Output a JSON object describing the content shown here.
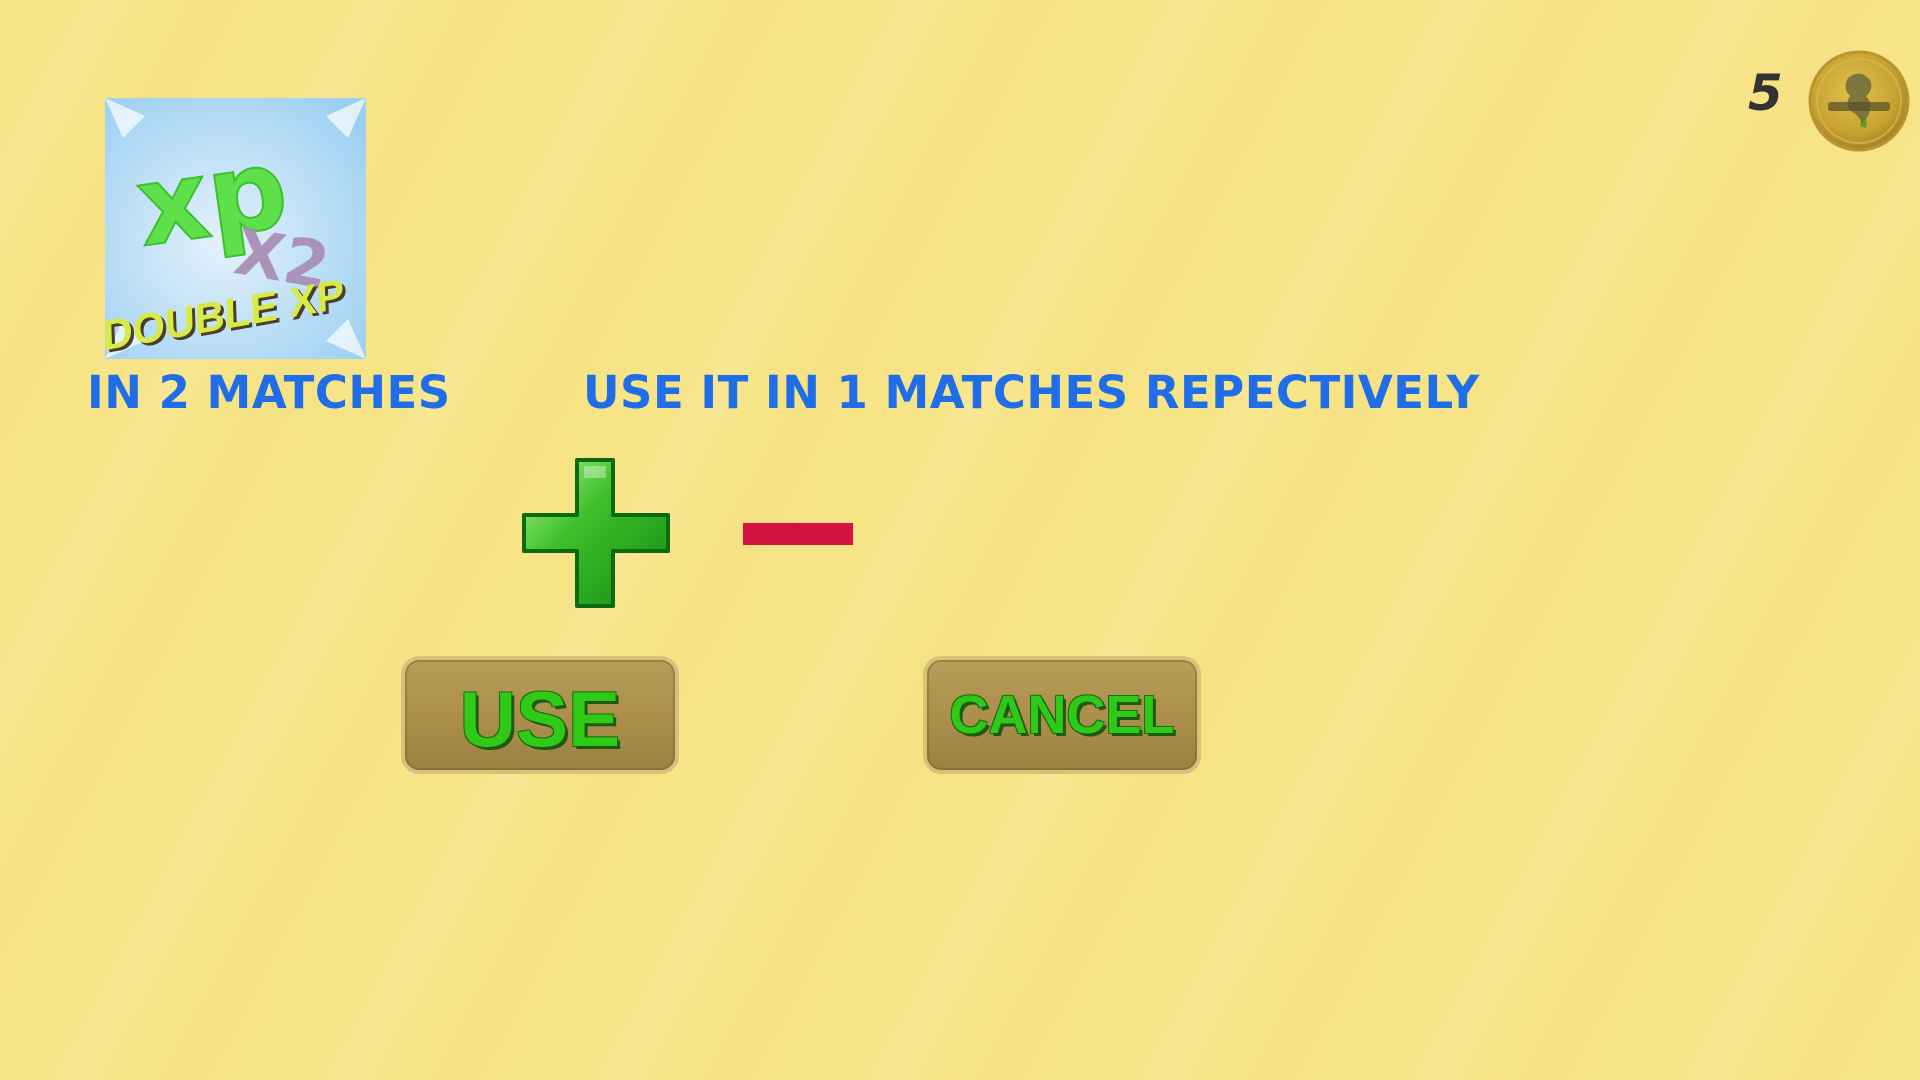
{
  "powerup": {
    "name": "double-xp",
    "card_text_xp": "xp",
    "card_text_multiplier": "X2",
    "card_text_title": "DOUBLE XP"
  },
  "info": {
    "owned_label": "IN 2 MATCHES",
    "use_label": "USE IT IN 1 MATCHES REPECTIVELY"
  },
  "controls": {
    "plus_icon": "plus-icon",
    "minus_icon": "minus-icon"
  },
  "buttons": {
    "use_label": "USE",
    "cancel_label": "CANCEL"
  },
  "currency": {
    "count": "5",
    "icon": "coin-icon"
  },
  "colors": {
    "background": "#f7e487",
    "label_blue": "#1f6ee8",
    "button_text_green": "#2fc917",
    "button_brown": "#aa8e4a",
    "minus_red": "#d4123f",
    "plus_green": "#22a81e"
  }
}
